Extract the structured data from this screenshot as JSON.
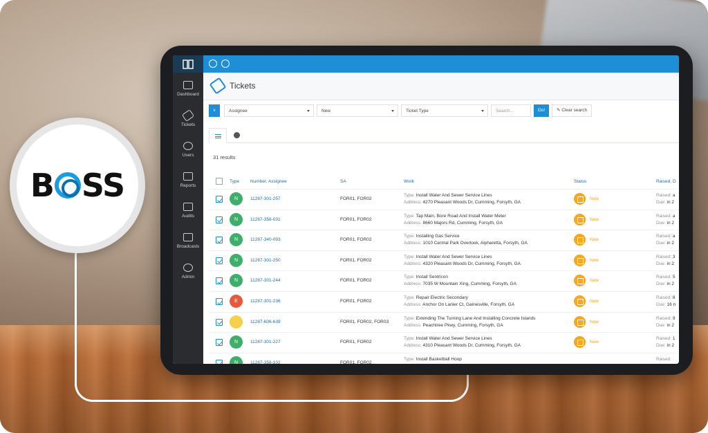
{
  "logo": {
    "left": "B",
    "right": "SS"
  },
  "app": {
    "page_title": "Tickets",
    "sidebar": [
      {
        "label": "Dashboard",
        "icon": "monitor-icon"
      },
      {
        "label": "Tickets",
        "icon": "tag-icon"
      },
      {
        "label": "Users",
        "icon": "users-icon"
      },
      {
        "label": "Reports",
        "icon": "chart-icon"
      },
      {
        "label": "Audits",
        "icon": "clipboard-icon"
      },
      {
        "label": "Broadcasts",
        "icon": "megaphone-icon"
      },
      {
        "label": "Admin",
        "icon": "gear-icon"
      }
    ],
    "filters": {
      "toggle": "v",
      "assignee": "Assignee",
      "status": "New",
      "ticket_type": "Ticket Type",
      "search_placeholder": "Search...",
      "go": "Go!",
      "clear": "Clear search"
    },
    "results": "31 results",
    "columns": {
      "type": "Type",
      "number": "Number, Assignee",
      "sa": "SA",
      "work": "Work",
      "status": "Status",
      "raised": "Raised, D"
    },
    "work_labels": {
      "type": "Type:",
      "address": "Address:"
    },
    "raised_labels": {
      "raised": "Raised:",
      "due": "Due:"
    },
    "rows": [
      {
        "letter": "N",
        "color": "#3fae6a",
        "number": "11287-301-257",
        "sa": "FOR01, FOR02",
        "work_type": "Install Water And Sewer Service Lines",
        "address": "4270 Pleasant Woods Dr, Cumming, Forsyth, GA",
        "status": "New",
        "raised": "a",
        "due": "in 2"
      },
      {
        "letter": "N",
        "color": "#3fae6a",
        "number": "11287-358-031",
        "sa": "FOR01, FOR02",
        "work_type": "Tap Main, Bore Road And Install Water Meter",
        "address": "8660 Majors Rd, Cumming, Forsyth, GA",
        "status": "New",
        "raised": "a",
        "due": "in 2"
      },
      {
        "letter": "N",
        "color": "#3fae6a",
        "number": "11287-340-093",
        "sa": "FOR01, FOR02",
        "work_type": "Installing Gas Service",
        "address": "1010 Central Park Overlook, Alpharetta, Forsyth, GA",
        "status": "New",
        "raised": "a",
        "due": "in 2"
      },
      {
        "letter": "N",
        "color": "#3fae6a",
        "number": "11287-301-250",
        "sa": "FOR01, FOR02",
        "work_type": "Install Water And Sewer Service Lines",
        "address": "4320 Pleasant Woods Dr, Cumming, Forsyth, GA",
        "status": "New",
        "raised": "3",
        "due": "in 2"
      },
      {
        "letter": "N",
        "color": "#3fae6a",
        "number": "11287-301-244",
        "sa": "FOR01, FOR02",
        "work_type": "Install Sentricon",
        "address": "7035 W Mountain Xing, Cumming, Forsyth, GA",
        "status": "New",
        "raised": "5",
        "due": "in 2"
      },
      {
        "letter": "E",
        "color": "#e8593c",
        "number": "11287-301-236",
        "sa": "FOR01, FOR02",
        "work_type": "Repair Electric Secondary",
        "address": "Anchor On Lanier Ct, Gainesville, Forsyth, GA",
        "status": "New",
        "raised": "8",
        "due": "16 n"
      },
      {
        "letter": "",
        "color": "#f5d04a",
        "number": "11287-606-639",
        "sa": "FOR01, FOR02, FOR03",
        "work_type": "Extending The Turning Lane And Installing Concrete Islands",
        "address": "Peachtree Pkwy, Cumming, Forsyth, GA",
        "status": "New",
        "raised": "9",
        "due": "in 2"
      },
      {
        "letter": "N",
        "color": "#3fae6a",
        "number": "11287-301-227",
        "sa": "FOR01, FOR02",
        "work_type": "Install Water And Sewer Service Lines",
        "address": "4310 Pleasant Woods Dr, Cumming, Forsyth, GA",
        "status": "New",
        "raised": "1",
        "due": "in 2"
      },
      {
        "letter": "N",
        "color": "#3fae6a",
        "number": "11287-358-102",
        "sa": "FOR01, FOR02",
        "work_type": "Install Basketball Hoop",
        "address": "",
        "status": "",
        "raised": "",
        "due": ""
      }
    ]
  }
}
